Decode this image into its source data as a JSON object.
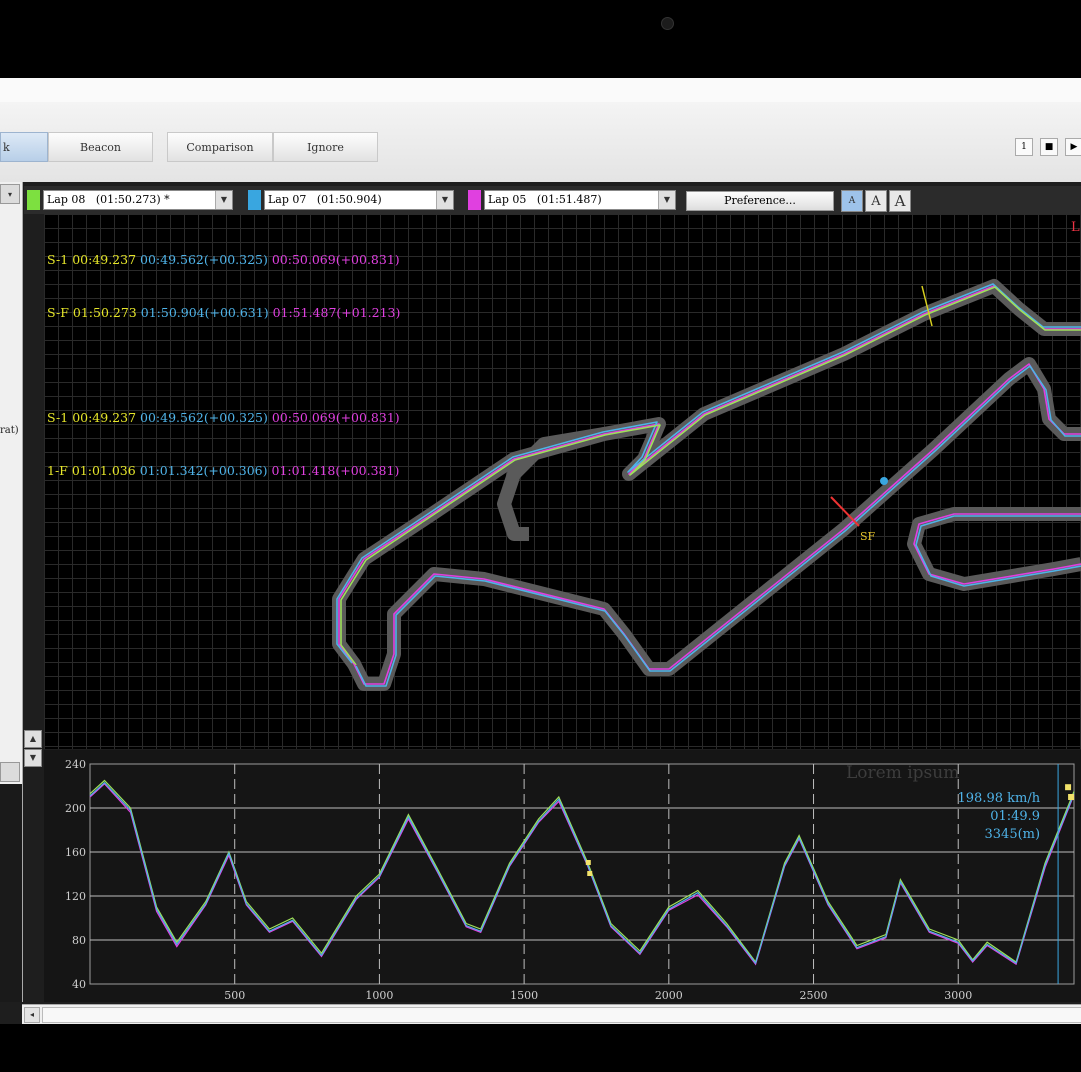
{
  "toolbar": {
    "buttons": [
      {
        "label": "k"
      },
      {
        "label": "Beacon"
      },
      {
        "label": "Comparison"
      },
      {
        "label": "Ignore"
      }
    ],
    "controls": [
      "1",
      "■",
      "▶"
    ]
  },
  "left_panel": {
    "arrow": "▾",
    "label": "rat)"
  },
  "laps": [
    {
      "label": "Lap 08   (01:50.273) *",
      "color": "#7de040"
    },
    {
      "label": "Lap 07   (01:50.904)",
      "color": "#39a6e0"
    },
    {
      "label": "Lap 05   (01:51.487)",
      "color": "#e040e0"
    }
  ],
  "preference_label": "Preference...",
  "font_buttons": [
    "A",
    "A",
    "A"
  ],
  "splits": [
    {
      "name": "S-1",
      "a": "00:49.237",
      "b": "00:49.562(+00.325)",
      "c": "00:50.069(+00.831)"
    },
    {
      "name": "S-F",
      "a": "01:50.273",
      "b": "01:50.904(+00.631)",
      "c": "01:51.487(+01.213)"
    },
    {
      "name": "S-1",
      "a": "00:49.237",
      "b": "00:49.562(+00.325)",
      "c": "00:50.069(+00.831)"
    },
    {
      "name": "1-F",
      "a": "01:01.036",
      "b": "01:01.342(+00.306)",
      "c": "01:01.418(+00.381)"
    }
  ],
  "map": {
    "corner_label": "L",
    "sf_label": "SF"
  },
  "scroll_arrows": [
    "▲",
    "▼"
  ],
  "chart_data": {
    "type": "line",
    "xlim": [
      0,
      3400
    ],
    "ylim": [
      40,
      240
    ],
    "x_ticks": [
      500,
      1000,
      1500,
      2000,
      2500,
      3000
    ],
    "y_ticks": [
      40,
      80,
      120,
      160,
      200,
      240
    ],
    "grid": true,
    "watermark": "Lorem ipsum",
    "cursor": {
      "x": 3345,
      "speed_label": "198.98 km/h",
      "time_label": "01:49.9",
      "dist_label": "3345(m)"
    },
    "series": [
      {
        "color": "#9ee05a",
        "x": [
          0,
          50,
          140,
          230,
          300,
          400,
          480,
          540,
          620,
          700,
          800,
          920,
          1000,
          1100,
          1200,
          1300,
          1350,
          1450,
          1550,
          1620,
          1720,
          1800,
          1900,
          2000,
          2100,
          2200,
          2300,
          2400,
          2450,
          2550,
          2650,
          2750,
          2800,
          2900,
          2950,
          3000,
          3050,
          3100,
          3200,
          3300,
          3400
        ],
        "values": [
          213,
          225,
          200,
          110,
          78,
          115,
          160,
          115,
          90,
          100,
          68,
          120,
          140,
          194,
          145,
          95,
          90,
          150,
          190,
          210,
          150,
          95,
          70,
          110,
          125,
          95,
          60,
          150,
          175,
          115,
          75,
          85,
          135,
          90,
          85,
          80,
          62,
          78,
          60,
          150,
          215
        ]
      },
      {
        "color": "#e040e0",
        "x": [
          0,
          50,
          140,
          230,
          300,
          400,
          480,
          540,
          620,
          700,
          800,
          920,
          1000,
          1100,
          1200,
          1300,
          1350,
          1450,
          1550,
          1620,
          1720,
          1800,
          1900,
          2000,
          2100,
          2200,
          2300,
          2400,
          2450,
          2550,
          2650,
          2750,
          2800,
          2900,
          2950,
          3000,
          3050,
          3100,
          3200,
          3300,
          3400
        ],
        "values": [
          210,
          222,
          196,
          106,
          74,
          112,
          157,
          112,
          87,
          97,
          65,
          117,
          137,
          190,
          142,
          92,
          87,
          147,
          187,
          206,
          147,
          92,
          67,
          107,
          121,
          92,
          58,
          147,
          172,
          112,
          72,
          82,
          132,
          87,
          82,
          77,
          60,
          75,
          58,
          146,
          212
        ]
      },
      {
        "color": "#4fb3e8",
        "x": [
          0,
          50,
          140,
          230,
          300,
          400,
          480,
          540,
          620,
          700,
          800,
          920,
          1000,
          1100,
          1200,
          1300,
          1350,
          1450,
          1550,
          1620,
          1720,
          1800,
          1900,
          2000,
          2100,
          2200,
          2300,
          2400,
          2450,
          2550,
          2650,
          2750,
          2800,
          2900,
          2950,
          3000,
          3050,
          3100,
          3200,
          3300,
          3400
        ],
        "values": [
          211,
          223,
          198,
          108,
          76,
          113,
          159,
          113,
          88,
          98,
          66,
          118,
          138,
          192,
          143,
          93,
          88,
          148,
          188,
          208,
          148,
          93,
          68,
          108,
          123,
          93,
          59,
          148,
          173,
          113,
          73,
          83,
          133,
          88,
          83,
          78,
          61,
          76,
          59,
          148,
          213
        ]
      }
    ]
  }
}
